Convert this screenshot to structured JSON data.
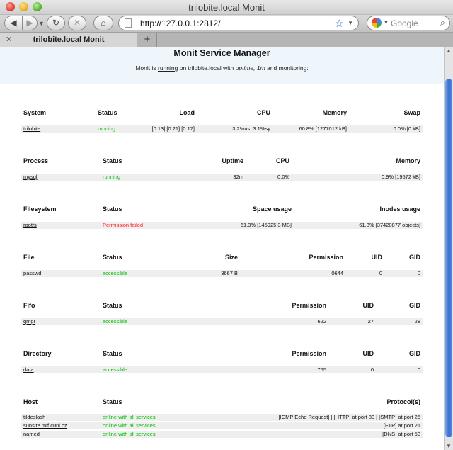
{
  "window": {
    "title": "trilobite.local Monit"
  },
  "toolbar": {
    "url": "http://127.0.0.1:2812/",
    "search_placeholder": "Google"
  },
  "tabs": [
    {
      "label": "trilobite.local Monit"
    }
  ],
  "page": {
    "title": "Monit Service Manager",
    "subtitle": {
      "prefix": "Monit is",
      "status_link": "running",
      "mid": "on trilobite.local with",
      "uptime_label": "uptime,",
      "uptime_value": "1m",
      "suffix": "and monitoring:"
    }
  },
  "sections": {
    "system": {
      "headers": [
        "System",
        "Status",
        "Load",
        "CPU",
        "Memory",
        "Swap"
      ],
      "rows": [
        {
          "name": "trilobite",
          "status": "running",
          "load": "[0.13] [0.21] [0.17]",
          "cpu": "3.2%us, 3.1%sy",
          "memory": "60.8% [1277012 kB]",
          "swap": "0.0% [0 kB]"
        }
      ]
    },
    "process": {
      "headers": [
        "Process",
        "Status",
        "Uptime",
        "CPU",
        "Memory"
      ],
      "rows": [
        {
          "name": "mysql",
          "status": "running",
          "uptime": "32m",
          "cpu": "0.0%",
          "memory": "0.9% [19572 kB]"
        }
      ]
    },
    "filesystem": {
      "headers": [
        "Filesystem",
        "Status",
        "Space usage",
        "Inodes usage"
      ],
      "rows": [
        {
          "name": "rootfs",
          "status": "Permission failed",
          "space": "61.3% [145925.3 MB]",
          "inodes": "61.3% [37420877 objects]"
        }
      ]
    },
    "file": {
      "headers": [
        "File",
        "Status",
        "Size",
        "Permission",
        "UID",
        "GID"
      ],
      "rows": [
        {
          "name": "passwd",
          "status": "accessible",
          "size": "3667 B",
          "permission": "0644",
          "uid": "0",
          "gid": "0"
        }
      ]
    },
    "fifo": {
      "headers": [
        "Fifo",
        "Status",
        "Permission",
        "UID",
        "GID"
      ],
      "rows": [
        {
          "name": "qmgr",
          "status": "accessible",
          "permission": "622",
          "uid": "27",
          "gid": "28"
        }
      ]
    },
    "directory": {
      "headers": [
        "Directory",
        "Status",
        "Permission",
        "UID",
        "GID"
      ],
      "rows": [
        {
          "name": "data",
          "status": "accessible",
          "permission": "755",
          "uid": "0",
          "gid": "0"
        }
      ]
    },
    "host": {
      "headers": [
        "Host",
        "Status",
        "Protocol(s)"
      ],
      "rows": [
        {
          "name": "tildeslash",
          "status": "online with all services",
          "protocols": "[ICMP Echo Request]  |  [HTTP] at port 80  |  [SMTP] at port 25"
        },
        {
          "name": "sunsite.mff.cuni.cz",
          "status": "online with all services",
          "protocols": "[FTP] at port 21"
        },
        {
          "name": "named",
          "status": "online with all services",
          "protocols": "[DNS] at port 53"
        }
      ]
    }
  },
  "colors": {
    "status_ok": "#00c000",
    "status_fail": "#ff1a1a",
    "header_bg": "#eef5fb",
    "row_bg": "#eeeeee"
  }
}
